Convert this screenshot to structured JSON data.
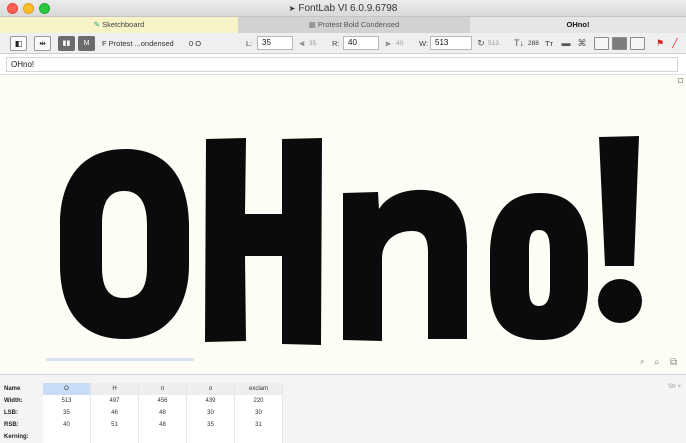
{
  "window": {
    "title": "FontLab VI 6.0.9.6798"
  },
  "tabs": [
    {
      "label": "Sketchboard",
      "icon": "brush-icon"
    },
    {
      "label": "Protest Bold Condensed",
      "icon": "grid-icon"
    },
    {
      "label": "OHno!"
    }
  ],
  "toolbar": {
    "font_name": "F Protest ...ondensed",
    "glyph_code": "0 O",
    "l_label": "L:",
    "l_value": "35",
    "l_dim": "35",
    "r_label": "R:",
    "r_value": "40",
    "r_dim": "40",
    "w_label": "W:",
    "w_value": "513",
    "w_dim": "513",
    "size_value": "288",
    "tool_t": "Tт"
  },
  "text_field": {
    "value": "OHno!"
  },
  "canvas": {
    "text": "OHno!"
  },
  "metrics": {
    "row_labels": [
      "Name",
      "Width:",
      "LSB:",
      "RSB:",
      "Kerning:"
    ],
    "columns": [
      {
        "name": "O",
        "width": "513",
        "lsb": "35",
        "rsb": "40"
      },
      {
        "name": "H",
        "width": "497",
        "lsb": "46",
        "rsb": "51"
      },
      {
        "name": "n",
        "width": "456",
        "lsb": "48",
        "rsb": "48"
      },
      {
        "name": "o",
        "width": "439",
        "lsb": "30",
        "rsb": "35"
      },
      {
        "name": "exclam",
        "width": "220",
        "lsb": "30",
        "rsb": "31"
      }
    ],
    "right_controls": "Str ×"
  },
  "colors": {
    "accent_selected": "#c9dcf6",
    "sketch_tab": "#f7f3c6"
  }
}
